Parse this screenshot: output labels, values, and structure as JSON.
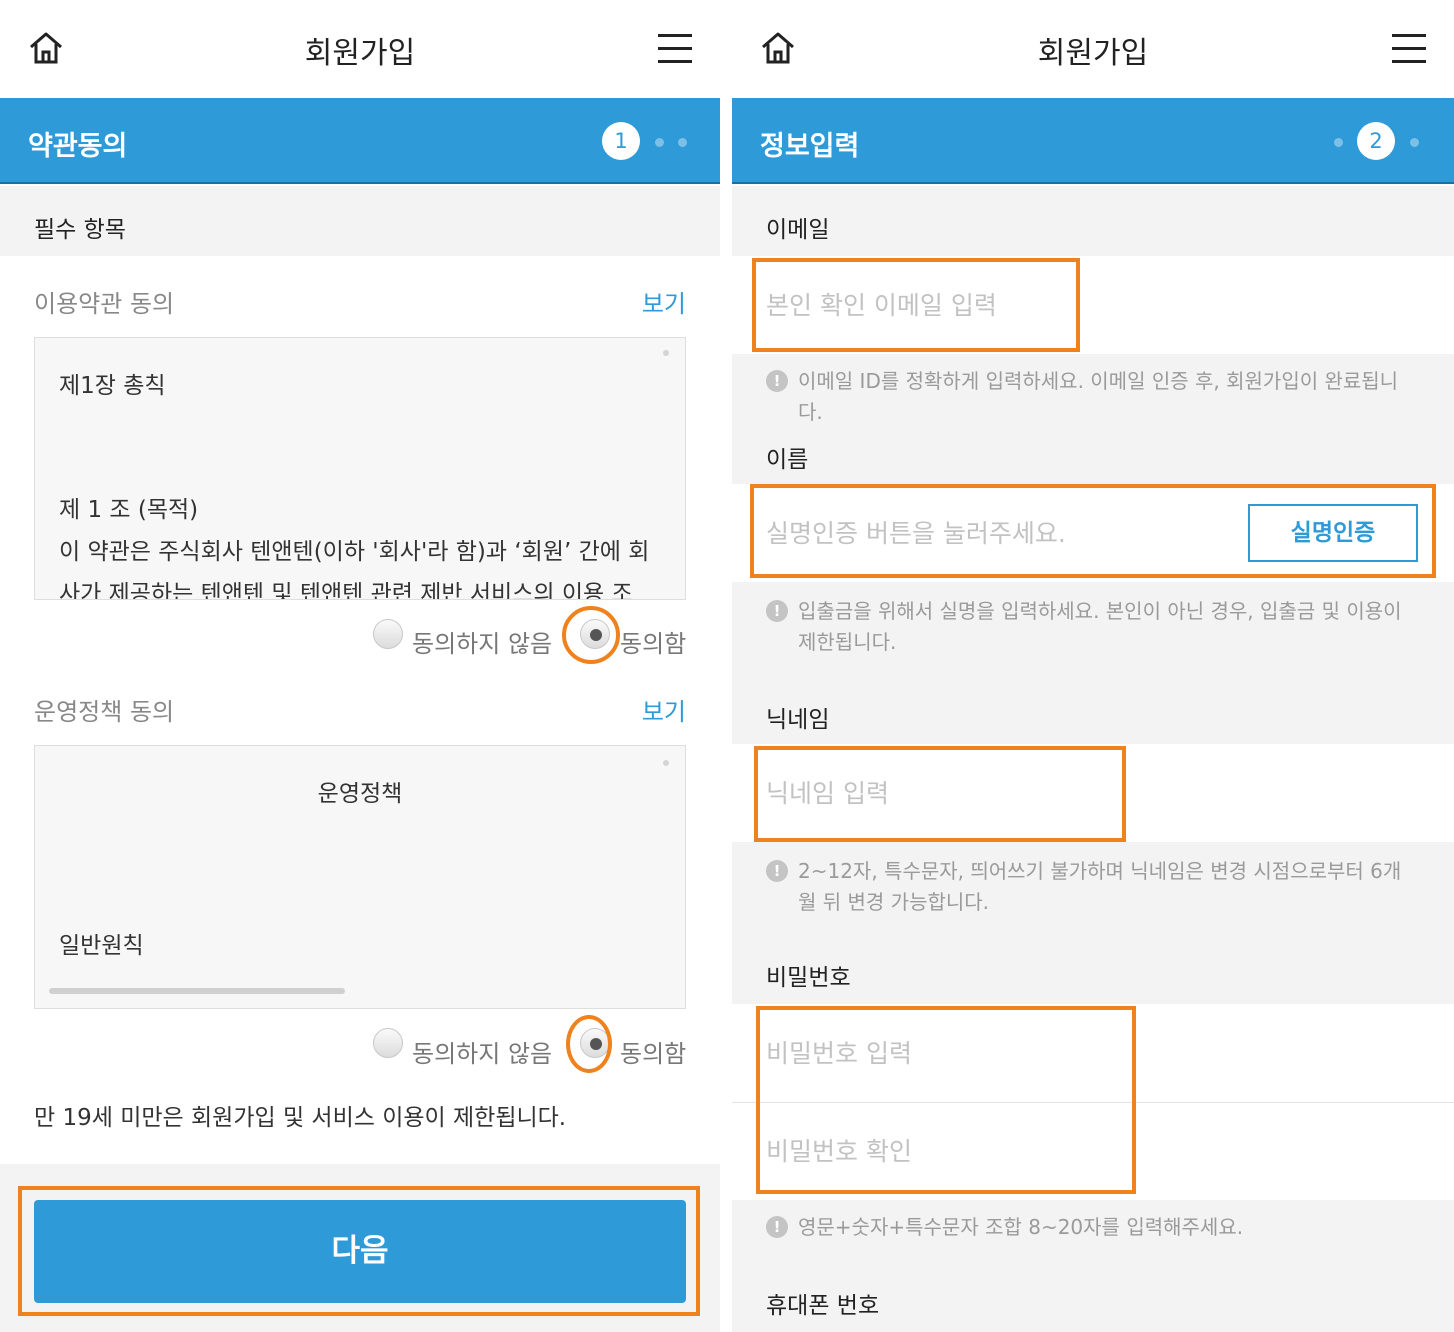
{
  "left": {
    "header": {
      "title": "회원가입"
    },
    "step": {
      "label": "약관동의",
      "number": "1"
    },
    "required_section": "필수 항목",
    "terms": {
      "title": "이용약관 동의",
      "view_label": "보기",
      "box_heading": "제1장 총칙",
      "box_article": "제 1 조 (목적)",
      "box_line1": "이 약관은 주식회사 텐앤텐(이하 '회사'라 함)과 ‘회원’ 간에 회",
      "box_line2": "사가 제공하는 텐앤텐 및 텐앤텐 관련 제반 서비스의 이용 조",
      "disagree_label": "동의하지 않음",
      "agree_label": "동의함"
    },
    "policy": {
      "title": "운영정책 동의",
      "view_label": "보기",
      "box_heading": "운영정책",
      "box_section": "일반원칙",
      "disagree_label": "동의하지 않음",
      "agree_label": "동의함"
    },
    "age_notice": "만 19세 미만은 회원가입 및 서비스 이용이 제한됩니다.",
    "next_button": "다음"
  },
  "right": {
    "header": {
      "title": "회원가입"
    },
    "step": {
      "label": "정보입력",
      "number": "2"
    },
    "email": {
      "label": "이메일",
      "placeholder": "본인 확인 이메일 입력",
      "hint": "이메일 ID를 정확하게 입력하세요. 이메일 인증 후, 회원가입이 완료됩니다."
    },
    "name": {
      "label": "이름",
      "placeholder": "실명인증 버튼을 눌러주세요.",
      "verify_button": "실명인증",
      "hint": "입출금을 위해서 실명을 입력하세요. 본인이 아닌 경우, 입출금 및 이용이 제한됩니다."
    },
    "nickname": {
      "label": "닉네임",
      "placeholder": "닉네임 입력",
      "hint": "2~12자, 특수문자, 띄어쓰기 불가하며 닉네임은 변경 시점으로부터 6개월 뒤 변경 가능합니다."
    },
    "password": {
      "label": "비밀번호",
      "placeholder": "비밀번호 입력",
      "confirm_placeholder": "비밀번호 확인",
      "hint": "영문+숫자+특수문자 조합 8~20자를 입력해주세요."
    },
    "phone": {
      "label": "휴대폰 번호"
    }
  },
  "colors": {
    "accent": "#2e9bd8",
    "highlight": "#f0821e",
    "band": "#f3f3f3"
  },
  "icons": {
    "home": "home-icon",
    "menu": "hamburger-menu-icon",
    "alert": "exclamation-icon"
  }
}
